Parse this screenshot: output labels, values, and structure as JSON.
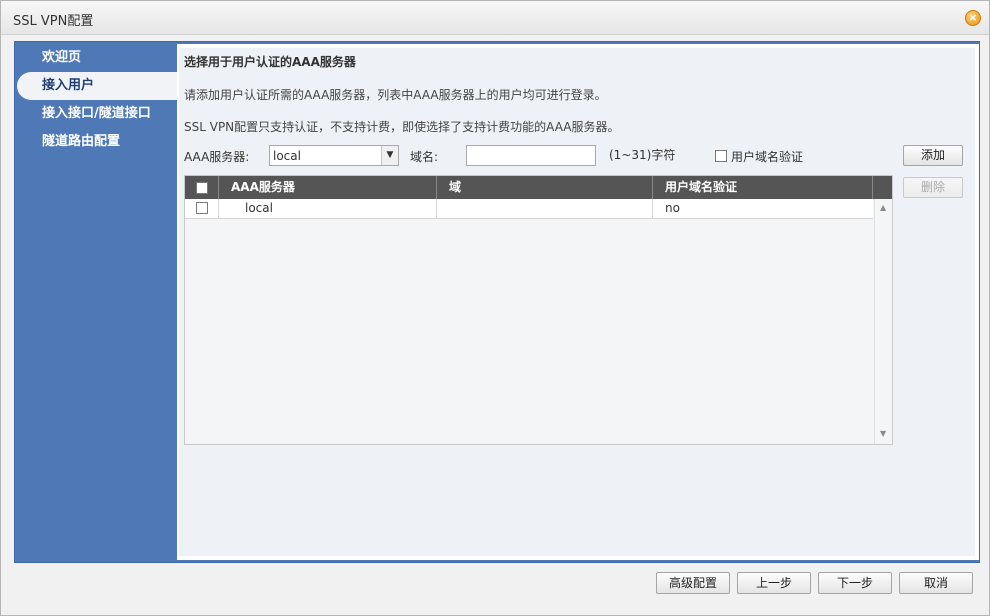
{
  "window": {
    "title": "SSL VPN配置",
    "close_symbol": "×"
  },
  "sidebar": {
    "items": [
      {
        "label": "欢迎页",
        "active": false
      },
      {
        "label": "接入用户",
        "active": true
      },
      {
        "label": "接入接口/隧道接口",
        "active": false
      },
      {
        "label": "隧道路由配置",
        "active": false
      }
    ]
  },
  "main": {
    "heading": "选择用于用户认证的AAA服务器",
    "desc1": "请添加用户认证所需的AAA服务器，列表中AAA服务器上的用户均可进行登录。",
    "desc2": "SSL VPN配置只支持认证，不支持计费，即使选择了支持计费功能的AAA服务器。",
    "form": {
      "aaa_label": "AAA服务器:",
      "aaa_selected": "local",
      "domain_label": "域名:",
      "domain_value": "",
      "domain_hint": "(1~31)字符",
      "user_domain_check_label": "用户域名验证",
      "user_domain_checked": false
    },
    "buttons": {
      "add": "添加",
      "delete": "删除"
    },
    "table": {
      "columns": [
        "AAA服务器",
        "域",
        "用户域名验证"
      ],
      "rows": [
        {
          "server": "local",
          "domain": "",
          "verify": "no"
        }
      ]
    }
  },
  "footer": {
    "advanced": "高级配置",
    "prev": "上一步",
    "next": "下一步",
    "cancel": "取消"
  }
}
